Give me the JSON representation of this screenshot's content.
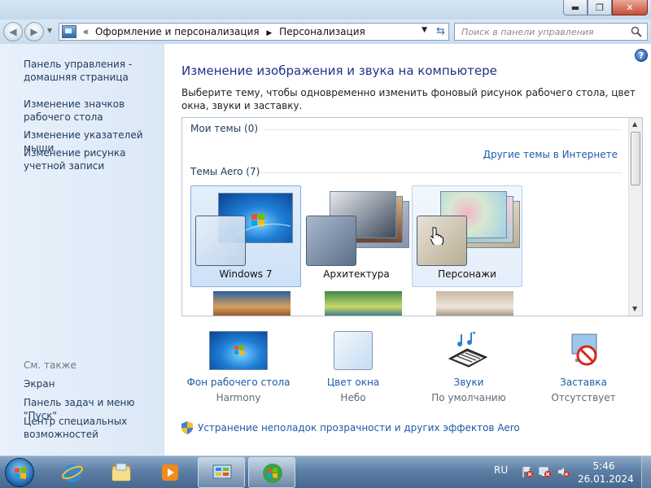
{
  "window": {
    "minimize_glyph": "▬",
    "maximize_glyph": "❐",
    "close_glyph": "✕"
  },
  "navbar": {
    "back_glyph": "◀",
    "forward_glyph": "▶",
    "chevron": "«",
    "breadcrumb": [
      "Оформление и персонализация",
      "Персонализация"
    ],
    "separator": "▶",
    "search_placeholder": "Поиск в панели управления"
  },
  "sidebar": {
    "links": [
      "Панель управления - домашняя страница",
      "Изменение значков рабочего стола",
      "Изменение указателей мыши",
      "Изменение рисунка учетной записи"
    ],
    "see_also_title": "См. также",
    "see_also_links": [
      "Экран",
      "Панель задач и меню \"Пуск\"",
      "Центр специальных возможностей"
    ]
  },
  "main": {
    "help_glyph": "?",
    "title": "Изменение изображения и звука на компьютере",
    "description": "Выберите тему, чтобы одновременно изменить фоновый рисунок рабочего стола, цвет окна, звуки и заставку.",
    "my_themes": "Мои темы (0)",
    "online_themes": "Другие темы в Интернете",
    "aero_themes": "Темы Aero (7)",
    "themes": [
      "Windows 7",
      "Архитектура",
      "Персонажи"
    ],
    "selected_theme": "Windows 7"
  },
  "options": [
    {
      "label": "Фон рабочего стола",
      "value": "Harmony",
      "icon": "desktop-background-icon"
    },
    {
      "label": "Цвет окна",
      "value": "Небо",
      "icon": "window-color-icon"
    },
    {
      "label": "Звуки",
      "value": "По умолчанию",
      "icon": "sounds-icon"
    },
    {
      "label": "Заставка",
      "value": "Отсутствует",
      "icon": "screensaver-icon"
    }
  ],
  "troubleshoot": "Устранение неполадок прозрачности и других эффектов Aero",
  "taskbar": {
    "language": "RU",
    "time": "5:46",
    "date": "26.01.2024"
  },
  "colors": {
    "link": "#1e5aa8",
    "title": "#1e3287",
    "sidebar_bg": "#e3eef9",
    "selection": "#cde1f7"
  }
}
